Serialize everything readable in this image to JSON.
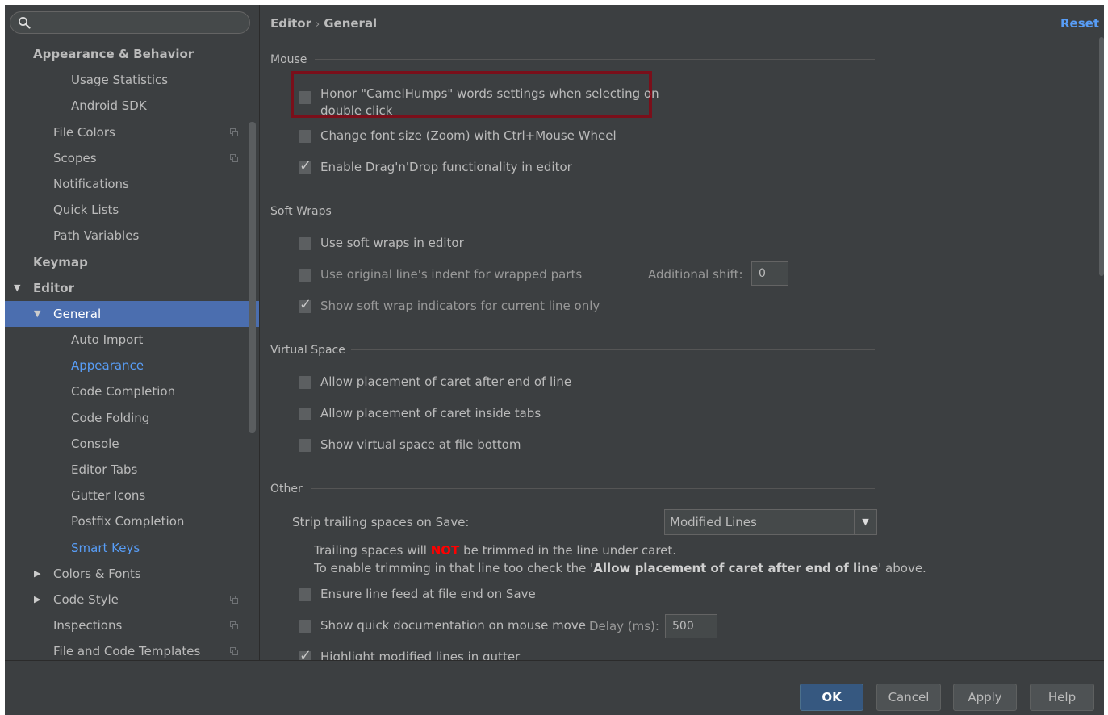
{
  "search": {
    "value": "",
    "placeholder": ""
  },
  "sidebar": {
    "items": [
      {
        "label": "Appearance & Behavior",
        "indent": 1,
        "bold": true
      },
      {
        "label": "Usage Statistics",
        "indent": 3
      },
      {
        "label": "Android SDK",
        "indent": 3
      },
      {
        "label": "File Colors",
        "indent": 2,
        "copy_icon": true
      },
      {
        "label": "Scopes",
        "indent": 2,
        "copy_icon": true
      },
      {
        "label": "Notifications",
        "indent": 2
      },
      {
        "label": "Quick Lists",
        "indent": 2
      },
      {
        "label": "Path Variables",
        "indent": 2
      },
      {
        "label": "Keymap",
        "indent": 1,
        "bold": true
      },
      {
        "label": "Editor",
        "indent": 1,
        "bold": true,
        "expanded": true
      },
      {
        "label": "General",
        "indent": 2,
        "expanded": true,
        "selected": true
      },
      {
        "label": "Auto Import",
        "indent": 3
      },
      {
        "label": "Appearance",
        "indent": 3,
        "link": true
      },
      {
        "label": "Code Completion",
        "indent": 3
      },
      {
        "label": "Code Folding",
        "indent": 3
      },
      {
        "label": "Console",
        "indent": 3
      },
      {
        "label": "Editor Tabs",
        "indent": 3
      },
      {
        "label": "Gutter Icons",
        "indent": 3
      },
      {
        "label": "Postfix Completion",
        "indent": 3
      },
      {
        "label": "Smart Keys",
        "indent": 3,
        "link": true
      },
      {
        "label": "Colors & Fonts",
        "indent": 2,
        "collapsed": true
      },
      {
        "label": "Code Style",
        "indent": 2,
        "collapsed": true,
        "copy_icon": true
      },
      {
        "label": "Inspections",
        "indent": 2,
        "copy_icon": true
      },
      {
        "label": "File and Code Templates",
        "indent": 2,
        "copy_icon": true
      }
    ]
  },
  "breadcrumb": {
    "parent": "Editor",
    "separator": "›",
    "current": "General"
  },
  "reset_label": "Reset",
  "sections": {
    "mouse": {
      "title": "Mouse",
      "camelhumps": "Honor \"CamelHumps\" words settings when selecting on double click",
      "zoom": "Change font size (Zoom) with Ctrl+Mouse Wheel",
      "dragdrop": "Enable Drag'n'Drop functionality in editor"
    },
    "soft_wraps": {
      "title": "Soft Wraps",
      "use_soft_wraps": "Use soft wraps in editor",
      "original_indent": "Use original line's indent for wrapped parts",
      "additional_shift_label": "Additional shift:",
      "additional_shift_value": "0",
      "show_indicators": "Show soft wrap indicators for current line only"
    },
    "virtual_space": {
      "title": "Virtual Space",
      "after_end": "Allow placement of caret after end of line",
      "inside_tabs": "Allow placement of caret inside tabs",
      "file_bottom": "Show virtual space at file bottom"
    },
    "other": {
      "title": "Other",
      "strip_label": "Strip trailing spaces on Save:",
      "strip_value": "Modified Lines",
      "notice1_pre": "Trailing spaces will ",
      "notice1_warn": "NOT",
      "notice1_post": " be trimmed in the line under caret.",
      "notice2_pre": "To enable trimming in that line too check the '",
      "notice2_strong": "Allow placement of caret after end of line",
      "notice2_post": "' above.",
      "line_feed": "Ensure line feed at file end on Save",
      "quick_doc": "Show quick documentation on mouse move",
      "delay_label": "Delay (ms):",
      "delay_value": "500",
      "highlight_modified": "Highlight modified lines in gutter"
    }
  },
  "buttons": {
    "ok": "OK",
    "cancel": "Cancel",
    "apply": "Apply",
    "help": "Help"
  },
  "colors": {
    "background": "#3c3f41",
    "selection": "#4b6eaf",
    "link": "#589df6",
    "highlight_border": "#7a0f1a",
    "warning": "#ff0000"
  }
}
